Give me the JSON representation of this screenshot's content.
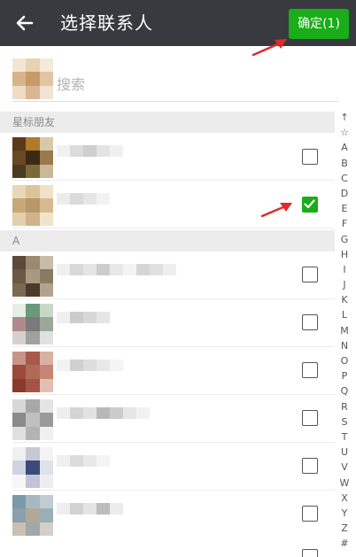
{
  "header": {
    "back_icon": "arrow-left-icon",
    "title": "选择联系人",
    "confirm_label": "确定(1)"
  },
  "search": {
    "placeholder": "搜索"
  },
  "sections": {
    "starred": "星标朋友",
    "a": "A"
  },
  "contacts": [
    {
      "section": "starred",
      "checked": false
    },
    {
      "section": "starred",
      "checked": true
    },
    {
      "section": "a",
      "checked": false
    },
    {
      "section": "a",
      "checked": false
    },
    {
      "section": "a",
      "checked": false
    },
    {
      "section": "a",
      "checked": false
    },
    {
      "section": "a",
      "checked": false
    },
    {
      "section": "a",
      "checked": false
    }
  ],
  "index_letters": [
    "↑",
    "☆",
    "A",
    "B",
    "C",
    "D",
    "E",
    "F",
    "G",
    "H",
    "I",
    "J",
    "K",
    "L",
    "M",
    "N",
    "O",
    "P",
    "Q",
    "R",
    "S",
    "T",
    "U",
    "V",
    "W",
    "X",
    "Y",
    "Z",
    "#"
  ],
  "colors": {
    "header_bg": "#393a3f",
    "accent_green": "#1aad19",
    "annotation_red": "#e02a2a"
  }
}
